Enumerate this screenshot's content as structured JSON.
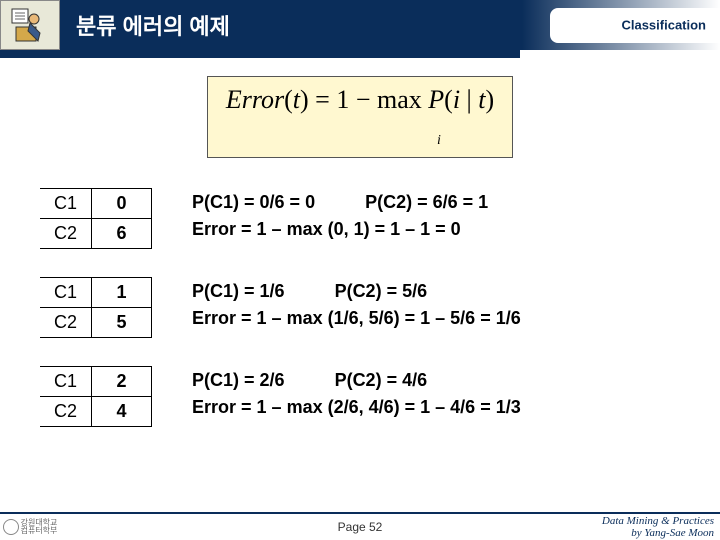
{
  "header": {
    "title": "분류 에러의 예제",
    "corner_label": "Classification"
  },
  "formula": {
    "text": "Error(t) = 1 − max P(i | t)",
    "sub": "i"
  },
  "examples": [
    {
      "rows": [
        [
          "C1",
          "0"
        ],
        [
          "C2",
          "6"
        ]
      ],
      "probs": {
        "pc1": "P(C1) = 0/6 = 0",
        "pc2": "P(C2) = 6/6 = 1"
      },
      "error": "Error = 1 – max (0, 1) = 1 – 1 = 0"
    },
    {
      "rows": [
        [
          "C1",
          "1"
        ],
        [
          "C2",
          "5"
        ]
      ],
      "probs": {
        "pc1": "P(C1) = 1/6",
        "pc2": "P(C2) = 5/6"
      },
      "error": "Error = 1 – max (1/6, 5/6) = 1 – 5/6 = 1/6"
    },
    {
      "rows": [
        [
          "C1",
          "2"
        ],
        [
          "C2",
          "4"
        ]
      ],
      "probs": {
        "pc1": "P(C1) = 2/6",
        "pc2": "P(C2) = 4/6"
      },
      "error": "Error = 1 – max (2/6, 4/6) = 1 – 4/6 = 1/3"
    }
  ],
  "footer": {
    "page": "Page 52",
    "attr1": "Data Mining & Practices",
    "attr2": "by Yang-Sae Moon"
  }
}
